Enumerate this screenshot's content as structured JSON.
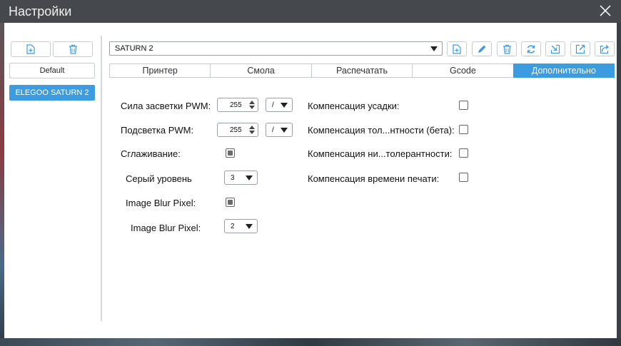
{
  "window": {
    "title": "Настройки"
  },
  "sidebar": {
    "profiles": [
      {
        "label": "Default",
        "active": false
      },
      {
        "label": "ELEGOO SATURN 2",
        "active": true
      }
    ]
  },
  "printer_select": {
    "value": "SATURN 2"
  },
  "tabs": [
    {
      "label": "Принтер",
      "active": false
    },
    {
      "label": "Смола",
      "active": false
    },
    {
      "label": "Распечатать",
      "active": false
    },
    {
      "label": "Gcode",
      "active": false
    },
    {
      "label": "Дополнительно",
      "active": true
    }
  ],
  "settings": {
    "pwm_exposure": {
      "label": "Сила засветки PWM:",
      "value": "255",
      "unit": "/"
    },
    "pwm_backlight": {
      "label": "Подсветка PWM:",
      "value": "255",
      "unit": "/"
    },
    "antialiasing": {
      "label": "Сглаживание:",
      "checked": true
    },
    "gray_level": {
      "label": "Серый уровень",
      "value": "3"
    },
    "image_blur": {
      "label": "Image Blur Pixel:",
      "checked": true
    },
    "image_blur_pixel": {
      "label": "Image Blur Pixel:",
      "value": "2"
    },
    "shrink_comp": {
      "label": "Компенсация усадки:",
      "checked": false
    },
    "tol_comp": {
      "label": "Компенсация тол...нтности (бета):",
      "checked": false
    },
    "neg_tol_comp": {
      "label": "Компенсация ни...толерантности:",
      "checked": false
    },
    "time_comp": {
      "label": "Компенсация времени печати:",
      "checked": false
    }
  },
  "colors": {
    "accent": "#3d9be0",
    "titlebar": "#45494e"
  }
}
